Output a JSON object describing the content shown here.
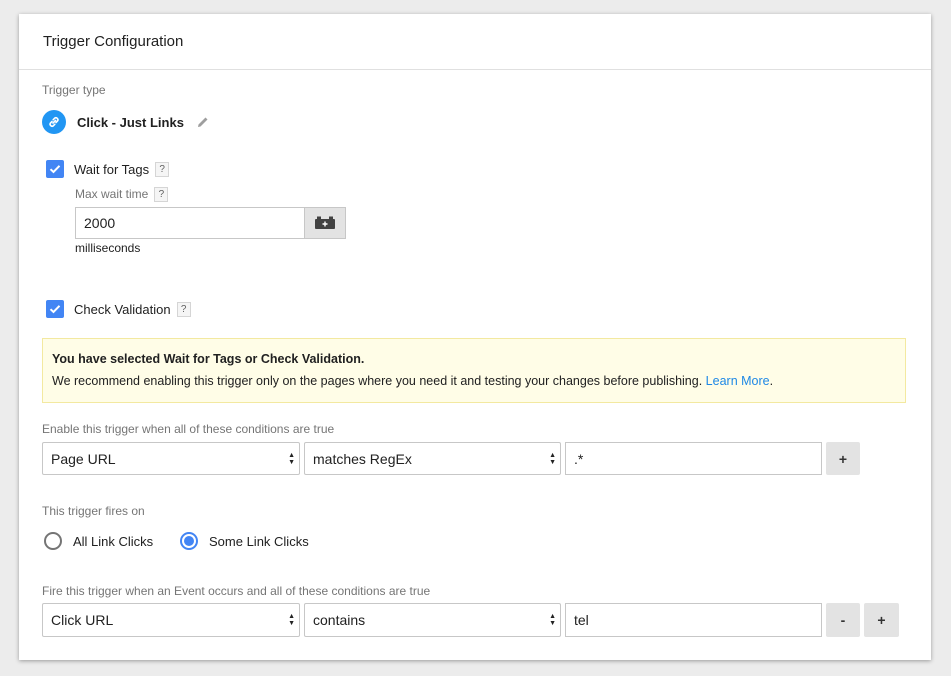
{
  "header": {
    "title": "Trigger Configuration"
  },
  "trigger_type": {
    "label": "Trigger type",
    "value": "Click - Just Links"
  },
  "wait_for_tags": {
    "label": "Wait for Tags",
    "help": "?",
    "checked": true,
    "max_wait_label": "Max wait time",
    "max_wait_help": "?",
    "max_wait_value": "2000",
    "unit": "milliseconds"
  },
  "check_validation": {
    "label": "Check Validation",
    "help": "?",
    "checked": true
  },
  "warning": {
    "title": "You have selected Wait for Tags or Check Validation.",
    "body": "We recommend enabling this trigger only on the pages where you need it and testing your changes before publishing.",
    "link": "Learn More",
    "end": "."
  },
  "enable_conditions": {
    "label": "Enable this trigger when all of these conditions are true",
    "variable": "Page URL",
    "operator": "matches RegEx",
    "value": ".*",
    "add": "+"
  },
  "fires_on": {
    "label": "This trigger fires on",
    "options": [
      "All Link Clicks",
      "Some Link Clicks"
    ],
    "selected": "Some Link Clicks"
  },
  "fire_conditions": {
    "label": "Fire this trigger when an Event occurs and all of these conditions are true",
    "variable": "Click URL",
    "operator": "contains",
    "value": "tel",
    "remove": "-",
    "add": "+"
  },
  "colors": {
    "accent": "#4285f4",
    "link": "#1e88e5",
    "warning_bg": "#fffde7"
  }
}
